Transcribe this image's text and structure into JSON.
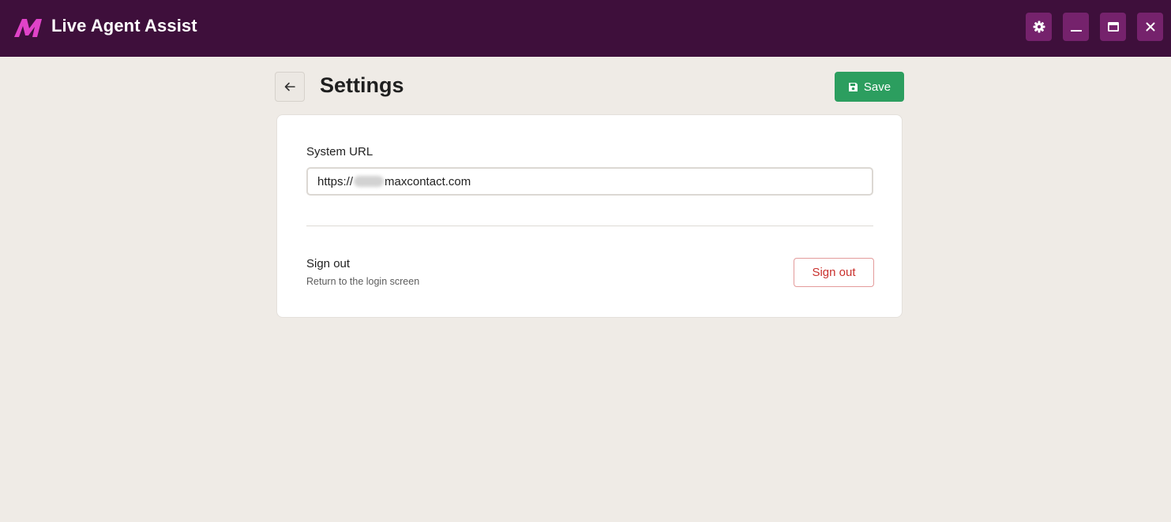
{
  "app": {
    "title": "Live Agent Assist",
    "logo_icon": "maxcontact-m-logo",
    "brand_color": "#3e0f3b",
    "logo_color": "#e043c8"
  },
  "window_controls": [
    {
      "name": "settings",
      "icon": "gear-icon"
    },
    {
      "name": "minimize",
      "icon": "minimize-icon"
    },
    {
      "name": "maximize",
      "icon": "maximize-icon"
    },
    {
      "name": "close",
      "icon": "close-icon"
    }
  ],
  "header": {
    "back_icon": "arrow-left-icon",
    "title": "Settings",
    "save_label": "Save",
    "save_icon": "floppy-disk-icon",
    "save_color": "#2c9e5f"
  },
  "settings": {
    "system_url": {
      "label": "System URL",
      "value_prefix": "https://",
      "value_suffix": "maxcontact.com"
    },
    "sign_out": {
      "title": "Sign out",
      "description": "Return to the login screen",
      "button_label": "Sign out",
      "button_color": "#c9302c"
    }
  }
}
